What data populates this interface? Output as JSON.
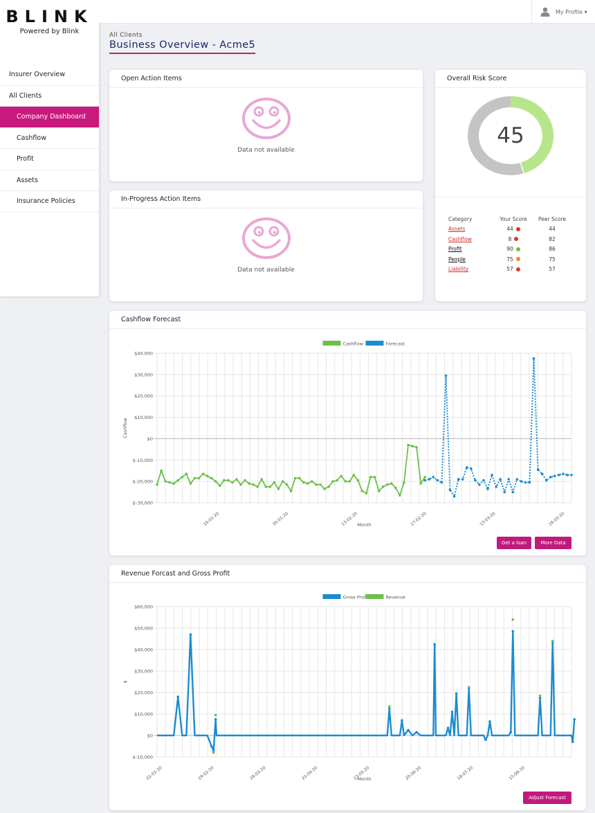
{
  "brand": {
    "logo": "BLINK",
    "tagline": "Powered by Blink"
  },
  "header": {
    "profile_label": "My Profile ▾"
  },
  "nav": [
    {
      "label": "Insurer Overview",
      "sub": false,
      "active": false
    },
    {
      "label": "All Clients",
      "sub": false,
      "active": false
    },
    {
      "label": "Company Dashboard",
      "sub": true,
      "active": true
    },
    {
      "label": "Cashflow",
      "sub": true,
      "active": false
    },
    {
      "label": "Profit",
      "sub": true,
      "active": false
    },
    {
      "label": "Assets",
      "sub": true,
      "active": false
    },
    {
      "label": "Insurance Policies",
      "sub": true,
      "active": false
    }
  ],
  "breadcrumb": "All Clients",
  "page_title": "Business Overview - Acme5",
  "open_items": {
    "title": "Open Action Items",
    "empty_text": "Data not available"
  },
  "progress_items": {
    "title": "In-Progress Action Items",
    "empty_text": "Data not available"
  },
  "risk": {
    "title": "Overall Risk Score",
    "score": "45",
    "score_fraction": 0.45,
    "colors": {
      "filled": "#b7e68a",
      "rest": "#c4c4c4"
    },
    "columns": [
      "Category",
      "Your Score",
      "Peer Score"
    ],
    "rows": [
      {
        "category": "Assets",
        "your": "44",
        "peer": "44",
        "dot": "#e2332b",
        "link_color": "#d62828"
      },
      {
        "category": "Cashflow",
        "your": "8",
        "peer": "82",
        "dot": "#e2332b",
        "link_color": "#d62828"
      },
      {
        "category": "Profit",
        "your": "90",
        "peer": "86",
        "dot": "#6cc04a",
        "link_color": "#111111"
      },
      {
        "category": "People",
        "your": "75",
        "peer": "75",
        "dot": "#f08a24",
        "link_color": "#111111"
      },
      {
        "category": "Liability",
        "your": "57",
        "peer": "57",
        "dot": "#e2332b",
        "link_color": "#d62828"
      }
    ]
  },
  "cashflow": {
    "title": "Cashflow Forecast",
    "buttons": [
      "Get a loan",
      "More Data"
    ]
  },
  "revenue": {
    "title": "Revenue Forcast and Gross Profit",
    "buttons": [
      "Adjust Forecast"
    ]
  },
  "chart_data": [
    {
      "type": "line",
      "title": "",
      "xlabel": "Month",
      "ylabel": "Cashflow",
      "ylim": [
        -30000,
        40000
      ],
      "yticks": [
        "$-30,000",
        "$-20,000",
        "$-10,000",
        "$0",
        "$10,000",
        "$20,000",
        "$30,000",
        "$40,000"
      ],
      "xticks": [
        "16-01-20",
        "30-01-20",
        "13-02-20",
        "27-02-20",
        "13-03-20",
        "26-03-20"
      ],
      "x_count": 100,
      "grid": true,
      "legend": "top",
      "series": [
        {
          "name": "Cashflow",
          "color": "#6cc04a",
          "style": "solid",
          "x": [
            0,
            1,
            2,
            3,
            4,
            5,
            6,
            7,
            8,
            9,
            10,
            11,
            12,
            13,
            14,
            15,
            16,
            17,
            18,
            19,
            20,
            21,
            22,
            23,
            24,
            25,
            26,
            27,
            28,
            29,
            30,
            31,
            32,
            33,
            34,
            35,
            36,
            37,
            38,
            39,
            40,
            41,
            42,
            43,
            44,
            45,
            46,
            47,
            48,
            49,
            50,
            51,
            52,
            53,
            54,
            55,
            56,
            57,
            58,
            59,
            60,
            61,
            62,
            63,
            64
          ],
          "values": [
            -21500,
            -15000,
            -20000,
            -20500,
            -21000,
            -19500,
            -18000,
            -16500,
            -21000,
            -18500,
            -18500,
            -16500,
            -17500,
            -18500,
            -20000,
            -22000,
            -19500,
            -19500,
            -20500,
            -19000,
            -21500,
            -19500,
            -21000,
            -21500,
            -22500,
            -19000,
            -22500,
            -22500,
            -20500,
            -23500,
            -20000,
            -21500,
            -24500,
            -18500,
            -18500,
            -20500,
            -21000,
            -20000,
            -21500,
            -21500,
            -23500,
            -22500,
            -20000,
            -19500,
            -17500,
            -20000,
            -20000,
            -17000,
            -19500,
            -24500,
            -25500,
            -18000,
            -18000,
            -24500,
            -22500,
            -21500,
            -21000,
            -23000,
            -26500,
            -20500,
            -3000,
            -3500,
            -4000,
            -21000,
            -18000
          ]
        },
        {
          "name": "Forecast",
          "color": "#1a8cd2",
          "style": "dotted",
          "x": [
            64,
            65,
            66,
            67,
            68,
            69,
            70,
            71,
            72,
            73,
            74,
            75,
            76,
            77,
            78,
            79,
            80,
            81,
            82,
            83,
            84,
            85,
            86,
            87,
            88,
            89,
            90,
            91,
            92,
            93,
            94,
            95,
            96,
            97,
            98,
            99
          ],
          "values": [
            -19500,
            -19000,
            -18000,
            -19500,
            -20500,
            29500,
            -24000,
            -27000,
            -19000,
            -19000,
            -13500,
            -14000,
            -19500,
            -21500,
            -19500,
            -23500,
            -17000,
            -22500,
            -19000,
            -25000,
            -19000,
            -25000,
            -19000,
            -20000,
            -20500,
            -20500,
            37500,
            -14500,
            -16500,
            -19500,
            -18000,
            -17500,
            -17000,
            -16500,
            -17000,
            -17000
          ]
        }
      ]
    },
    {
      "type": "line",
      "title": "",
      "xlabel": "Month",
      "ylabel": "$",
      "ylim": [
        -10000,
        60000
      ],
      "yticks": [
        "$-10,000",
        "$0",
        "$10,000",
        "$20,000",
        "$30,000",
        "$40,000",
        "$50,000",
        "$60,000"
      ],
      "xticks": [
        "01-02-20",
        "29-02-20",
        "28-03-20",
        "25-04-20",
        "23-05-20",
        "20-06-20",
        "18-07-20",
        "15-08-20"
      ],
      "x_count": 100,
      "grid": true,
      "legend": "top",
      "series": [
        {
          "name": "Gross Profit",
          "color": "#1a8cd2",
          "points": [
            [
              0,
              0
            ],
            [
              4,
              0
            ],
            [
              5,
              18000
            ],
            [
              6,
              0
            ],
            [
              7,
              0
            ],
            [
              8,
              47000
            ],
            [
              9,
              0
            ],
            [
              12,
              0
            ],
            [
              13,
              -5000
            ],
            [
              13.5,
              -7000
            ],
            [
              14,
              7500
            ],
            [
              14.2,
              0
            ],
            [
              55,
              0
            ],
            [
              55.5,
              12500
            ],
            [
              56,
              0
            ],
            [
              58,
              0
            ],
            [
              58.5,
              7000
            ],
            [
              59,
              0
            ],
            [
              60,
              2500
            ],
            [
              61,
              0
            ],
            [
              62,
              1500
            ],
            [
              63,
              0
            ],
            [
              66,
              0
            ],
            [
              66.3,
              42500
            ],
            [
              66.6,
              0
            ],
            [
              69,
              0
            ],
            [
              69.5,
              3500
            ],
            [
              70,
              0
            ],
            [
              70.5,
              11000
            ],
            [
              71,
              0
            ],
            [
              71.5,
              19500
            ],
            [
              72,
              0
            ],
            [
              74,
              0
            ],
            [
              74.5,
              22000
            ],
            [
              75,
              0
            ],
            [
              78,
              0
            ],
            [
              78.5,
              -2000
            ],
            [
              79,
              0
            ],
            [
              79.5,
              6500
            ],
            [
              80,
              0
            ],
            [
              84,
              0
            ],
            [
              84.5,
              1500
            ],
            [
              85,
              48500
            ],
            [
              85.5,
              0
            ],
            [
              91,
              0
            ],
            [
              91.5,
              17500
            ],
            [
              92,
              0
            ],
            [
              94,
              0
            ],
            [
              94.5,
              43500
            ],
            [
              95,
              0
            ],
            [
              99,
              0
            ],
            [
              99.3,
              -3000
            ],
            [
              99.7,
              7500
            ]
          ]
        },
        {
          "name": "Revenue",
          "color": "#6cc04a",
          "points": [
            [
              13.5,
              -8000
            ],
            [
              14,
              9500
            ],
            [
              55.5,
              13500
            ],
            [
              74.5,
              22500
            ],
            [
              85,
              54000
            ],
            [
              91.5,
              18500
            ],
            [
              94.5,
              44000
            ]
          ]
        }
      ]
    }
  ]
}
